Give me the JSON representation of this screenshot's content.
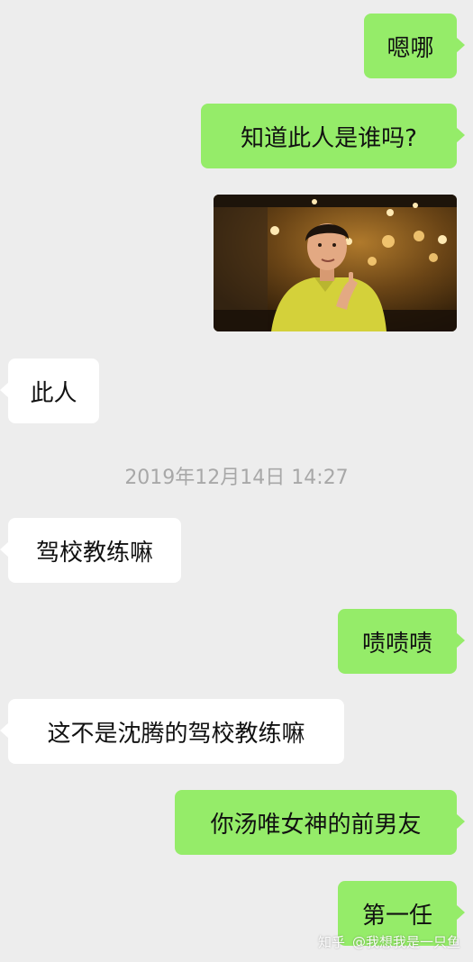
{
  "messages": [
    {
      "from": "me",
      "text": "嗯哪"
    },
    {
      "from": "me",
      "text": "知道此人是谁吗?"
    },
    {
      "from": "me",
      "type": "image",
      "description": "photo"
    },
    {
      "from": "them",
      "text": "此人"
    },
    {
      "from": "them",
      "text": "驾校教练嘛"
    },
    {
      "from": "me",
      "text": "啧啧啧"
    },
    {
      "from": "them",
      "text": "这不是沈腾的驾校教练嘛"
    },
    {
      "from": "me",
      "text": "你汤唯女神的前男友"
    },
    {
      "from": "me",
      "text": "第一任"
    }
  ],
  "timestamp": "2019年12月14日 14:27",
  "watermark": {
    "site": "知乎",
    "user": "@我想我是一只鱼"
  },
  "colors": {
    "background": "#ededed",
    "outgoing_bubble": "#95ec69",
    "incoming_bubble": "#ffffff",
    "timestamp_text": "#a8a8a8"
  }
}
